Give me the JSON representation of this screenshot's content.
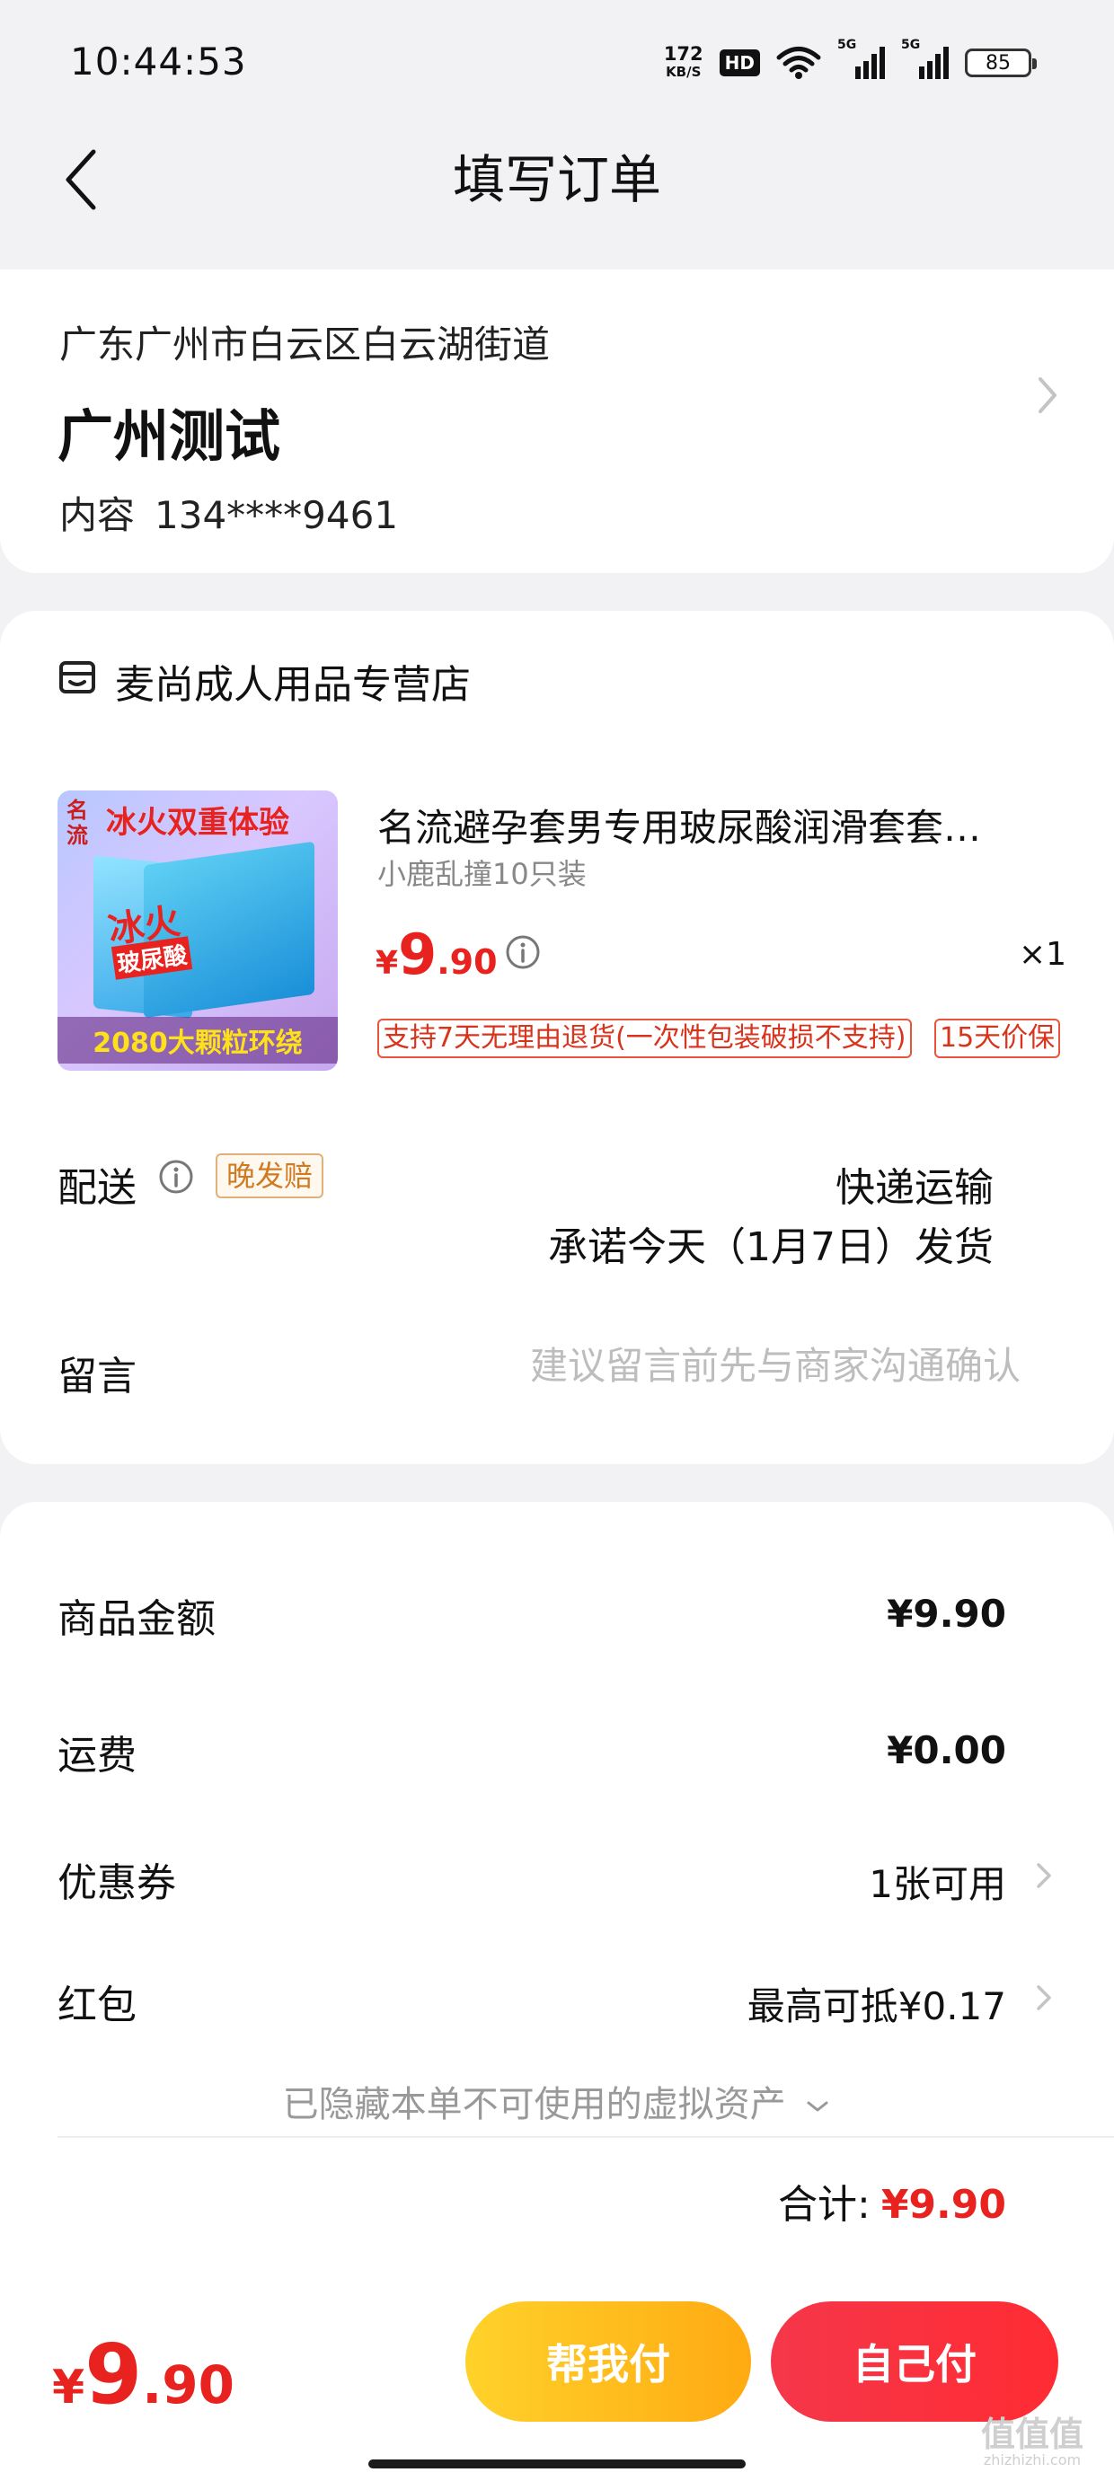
{
  "status_bar": {
    "time": "10:44:53",
    "net_speed_value": "172",
    "net_speed_unit": "KB/S",
    "hd_label": "HD",
    "signal1_label": "5G",
    "signal2_label": "5G",
    "battery": "85"
  },
  "nav": {
    "title": "填写订单"
  },
  "address": {
    "region": "广东广州市白云区白云湖街道",
    "name": "广州测试",
    "contact_label": "内容",
    "phone": "134****9461"
  },
  "shop": {
    "name": "麦尚成人用品专营店",
    "product": {
      "title": "名流避孕套男专用玻尿酸润滑套套…",
      "spec": "小鹿乱撞10只装",
      "price_currency": "¥",
      "price_int": "9",
      "price_dec": ".90",
      "quantity": "×1",
      "image_text": {
        "brand": "名流",
        "top": "冰火双重体验",
        "middle": "冰火",
        "middle2": "玻尿酸",
        "bottom": "2080大颗粒环绕"
      },
      "tags": [
        "支持7天无理由退货(一次性包装破损不支持)",
        "15天价保"
      ]
    },
    "delivery": {
      "label": "配送",
      "badge": "晚发赔",
      "method": "快递运输",
      "promise": "承诺今天（1月7日）发货"
    },
    "message": {
      "label": "留言",
      "value": "",
      "placeholder": "建议留言前先与商家沟通确认"
    }
  },
  "pricing": {
    "rows": [
      {
        "label": "商品金额",
        "value": "¥9.90"
      },
      {
        "label": "运费",
        "value": "¥0.00"
      },
      {
        "label": "优惠券",
        "value": "1张可用"
      },
      {
        "label": "红包",
        "value": "最高可抵¥0.17"
      }
    ],
    "hidden_assets": "已隐藏本单不可使用的虚拟资产",
    "total_label": "合计:",
    "total_value": "¥9.90"
  },
  "bottom_bar": {
    "price_currency": "¥",
    "price_int": "9",
    "price_dec": ".90",
    "help_pay": "帮我付",
    "self_pay": "自己付"
  },
  "watermark": {
    "text": "值值值",
    "sub": "zhizhizhi.com"
  },
  "colors": {
    "accent_red": "#e8221f",
    "help_pay_gradient": [
      "#ffd22a",
      "#ffaa12"
    ],
    "self_pay_gradient": [
      "#f5374a",
      "#ff2b33"
    ]
  }
}
